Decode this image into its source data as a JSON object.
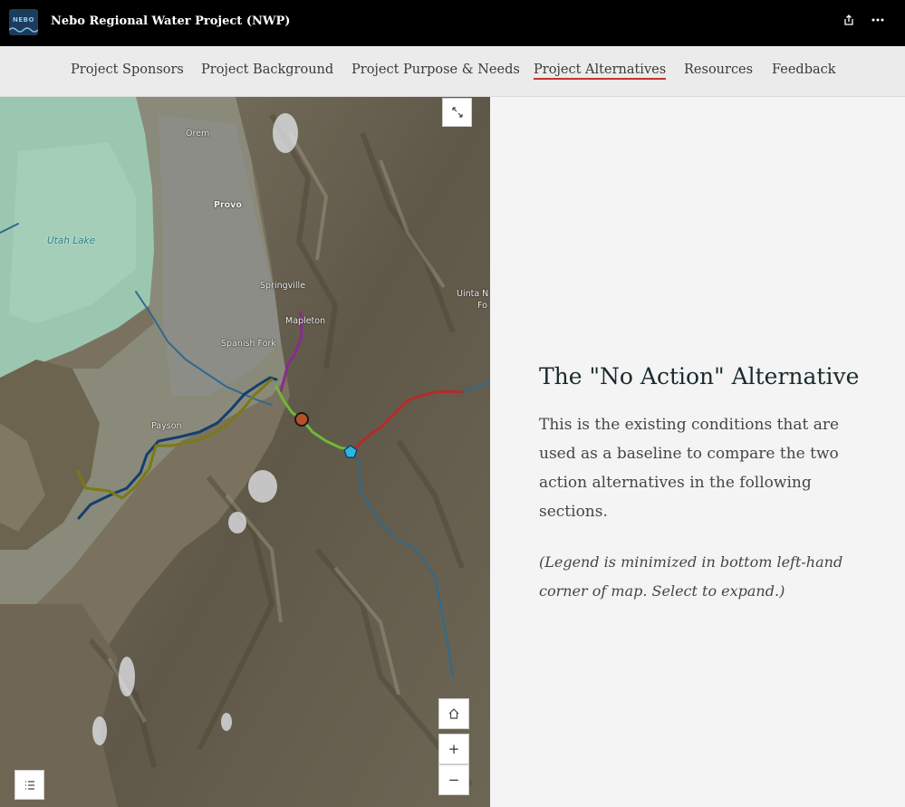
{
  "header": {
    "logo_text": "NEBO",
    "title": "Nebo Regional Water Project (NWP)",
    "share_icon": "share-icon",
    "more_icon": "more-icon"
  },
  "nav": {
    "items": [
      {
        "label": "Project Sponsors"
      },
      {
        "label": "Project Background"
      },
      {
        "label": "Project Purpose & Needs"
      },
      {
        "label": "Project Alternatives",
        "active": true
      },
      {
        "label": "Resources"
      },
      {
        "label": "Feedback"
      }
    ],
    "active_color": "#c0392b"
  },
  "map": {
    "place_labels": {
      "orem": "Orem",
      "provo": "Provo",
      "utah_lake": "Utah Lake",
      "springville": "Springville",
      "mapleton": "Mapleton",
      "spanish_fork": "Spanish Fork",
      "payson": "Payson",
      "uinta": "Uinta N",
      "uinta2": "Fo"
    },
    "buttons": {
      "expand_icon": "expand-icon",
      "home_icon": "home-icon",
      "zoom_in": "+",
      "zoom_out": "−",
      "legend_icon": "legend-icon"
    },
    "route_colors": {
      "red": "#b52a2a",
      "green": "#6fb83a",
      "purple": "#8a2b8f",
      "olive": "#7a7a14",
      "navy": "#153e6b",
      "blue": "#2e6a8f"
    }
  },
  "content": {
    "heading": "The \"No Action\" Alternative",
    "body": "This is the existing conditions that are used as a baseline to compare the two action alternatives in the following sections.",
    "note": "(Legend is minimized in bottom left-hand corner of map. Select to expand.)"
  }
}
